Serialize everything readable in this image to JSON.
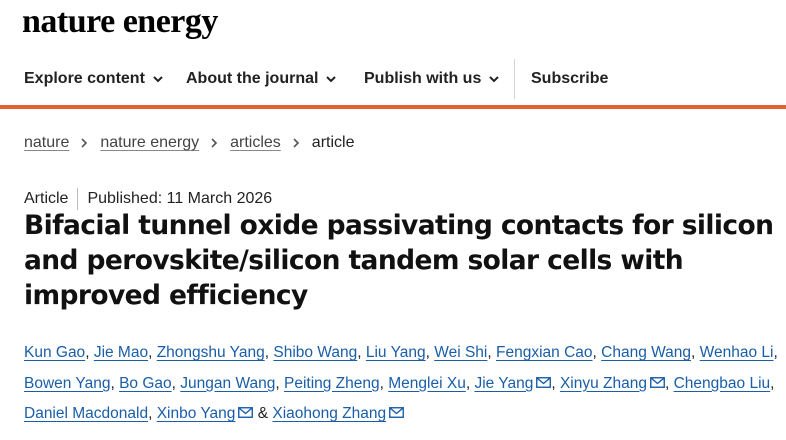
{
  "brand": "nature energy",
  "nav": {
    "explore": "Explore content",
    "about": "About the journal",
    "publish": "Publish with us",
    "subscribe": "Subscribe"
  },
  "breadcrumb": [
    "nature",
    "nature energy",
    "articles",
    "article"
  ],
  "article": {
    "type": "Article",
    "published": "Published: 11 March 2026",
    "title": "Bifacial tunnel oxide passivating contacts for silicon and perovskite/silicon tandem solar cells with improved efficiency"
  },
  "authors": {
    "list": [
      "Kun Gao",
      "Jie Mao",
      "Zhongshu Yang",
      "Shibo Wang",
      "Liu Yang",
      "Wei Shi",
      "Fengxian Cao",
      "Chang Wang",
      "Wenhao Li",
      "Bowen Yang",
      "Bo Gao",
      "Jungan Wang",
      "Peiting Zheng",
      "Menglei Xu",
      "Jie Yang",
      "Xinyu Zhang",
      "Chengbao Liu",
      "Daniel Macdonald",
      "Xinbo Yang",
      "Xiaohong Zhang"
    ],
    "sep": ", ",
    "amp": " & "
  },
  "colors": {
    "accent": "#e2632d",
    "link": "#1a5ea8"
  },
  "icons": {
    "nav_chevron": "chevron-down-icon",
    "crumb_sep": "chevron-right-icon",
    "corresponding": "mail-icon"
  }
}
